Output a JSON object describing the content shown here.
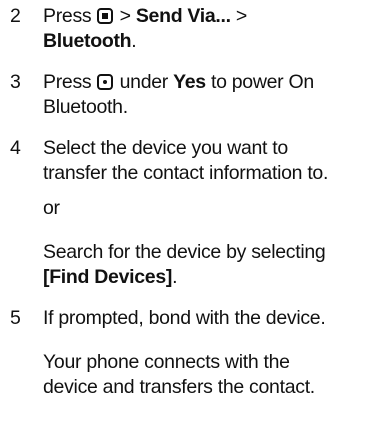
{
  "steps": [
    {
      "number": "2",
      "press": "Press",
      "gt1": ">",
      "send_via": "Send Via...",
      "gt2": ">",
      "bluetooth": "Bluetooth",
      "period": "."
    },
    {
      "number": "3",
      "press": "Press",
      "under": "under",
      "yes": "Yes",
      "rest1": "to power On",
      "rest2": "Bluetooth."
    },
    {
      "number": "4",
      "line1": "Select the device you want to",
      "line2": "transfer the contact information to.",
      "or": "or",
      "search1": "Search for the device by selecting",
      "find_devices": "[Find Devices]",
      "period": "."
    },
    {
      "number": "5",
      "line1": "If prompted, bond with the device.",
      "result1": "Your phone connects with the",
      "result2": "device and transfers the contact."
    }
  ],
  "icons": {
    "menu_key": "menu-key-icon",
    "center_key": "center-select-key-icon"
  }
}
